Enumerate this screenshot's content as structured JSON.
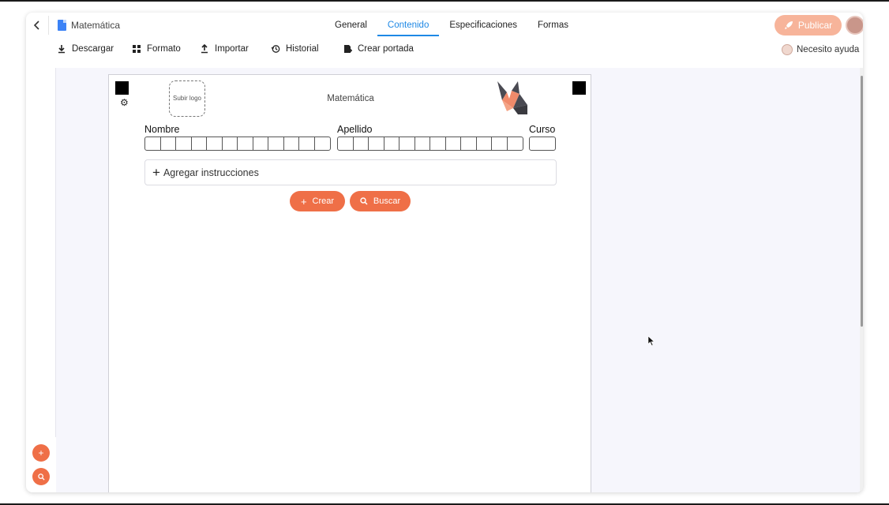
{
  "header": {
    "doc_title": "Matemática",
    "tabs": [
      {
        "label": "General",
        "active": false
      },
      {
        "label": "Contenido",
        "active": true
      },
      {
        "label": "Especificaciones",
        "active": false
      },
      {
        "label": "Formas",
        "active": false
      }
    ],
    "publish_label": "Publicar"
  },
  "toolbar": {
    "download_label": "Descargar",
    "format_label": "Formato",
    "import_label": "Importar",
    "history_label": "Historial",
    "cover_label": "Crear portada",
    "help_label": "Necesito ayuda"
  },
  "sheet": {
    "logo_upload_label": "Subir logo",
    "title": "Matemática",
    "fields": {
      "nombre_label": "Nombre",
      "apellido_label": "Apellido",
      "curso_label": "Curso"
    },
    "instructions_label": "Agregar instrucciones",
    "create_label": "Crear",
    "search_label": "Buscar"
  },
  "colors": {
    "accent": "#ef6f47",
    "accent_light": "#f7b49a",
    "tab_active": "#1e88e5",
    "canvas_bg": "#f6f6fc"
  },
  "icons": [
    "back-icon",
    "document-icon",
    "rocket-icon",
    "download-icon",
    "format-icon",
    "upload-icon",
    "history-icon",
    "cover-icon",
    "help-icon",
    "gear-icon",
    "fox-logo-icon",
    "plus-icon",
    "search-icon"
  ]
}
